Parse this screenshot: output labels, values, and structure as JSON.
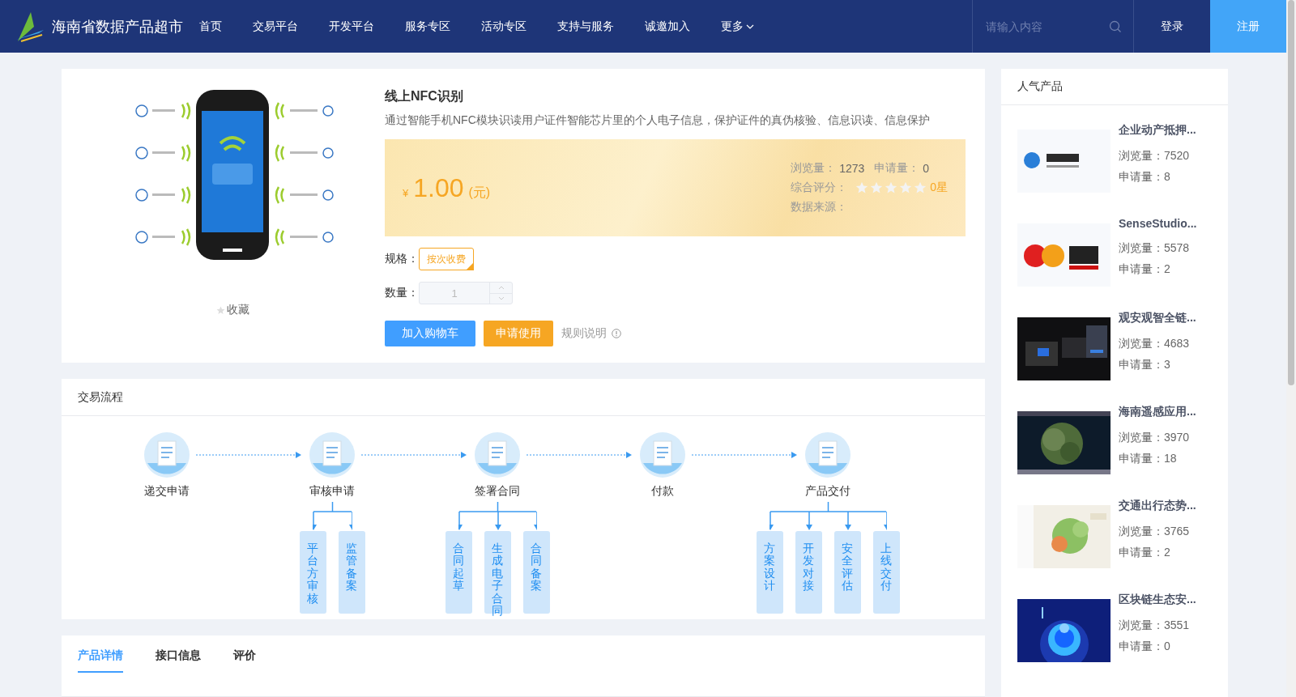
{
  "header": {
    "brand": "海南省数据产品超市",
    "nav": [
      {
        "label": "首页",
        "dropdown": false
      },
      {
        "label": "交易平台",
        "dropdown": false
      },
      {
        "label": "开发平台",
        "dropdown": false
      },
      {
        "label": "服务专区",
        "dropdown": false
      },
      {
        "label": "活动专区",
        "dropdown": false
      },
      {
        "label": "支持与服务",
        "dropdown": false
      },
      {
        "label": "诚邀加入",
        "dropdown": false
      },
      {
        "label": "更多",
        "dropdown": true
      }
    ],
    "search": {
      "placeholder": "请输入内容"
    },
    "login": "登录",
    "register": "注册"
  },
  "product": {
    "favorite": "收藏",
    "title": "线上NFC识别",
    "description": "通过智能手机NFC模块识读用户证件智能芯片里的个人电子信息，保护证件的真伪核验、信息识读、信息保护",
    "currency": "¥",
    "price": "1.00",
    "unit": "(元)",
    "views_label": "浏览量：",
    "views": "1273",
    "applies_label": "申请量：",
    "applies": "0",
    "rating_label": "综合评分：",
    "stars": 0,
    "rating_text": "0星",
    "source_label": "数据来源：",
    "spec_label": "规格：",
    "specs": [
      {
        "label": "按次收费",
        "selected": true
      }
    ],
    "qty_label": "数量：",
    "qty": "1",
    "cart_button": "加入购物车",
    "apply_button": "申请使用",
    "rules_link": "规则说明"
  },
  "flow": {
    "title": "交易流程",
    "steps": [
      {
        "label": "递交申请"
      },
      {
        "label": "审核申请",
        "children": [
          "平台方审核",
          "监管备案"
        ]
      },
      {
        "label": "签署合同",
        "children": [
          "合同起草",
          "生成电子合同",
          "合同备案"
        ]
      },
      {
        "label": "付款"
      },
      {
        "label": "产品交付",
        "children": [
          "方案设计",
          "开发对接",
          "安全评估",
          "上线交付"
        ]
      }
    ]
  },
  "tabs": [
    {
      "label": "产品详情",
      "selected": true
    },
    {
      "label": "接口信息",
      "selected": false
    },
    {
      "label": "评价",
      "selected": false
    }
  ],
  "popular": {
    "title": "人气产品",
    "items": [
      {
        "name": "企业动产抵押...",
        "views": "浏览量：7520",
        "applies": "申请量：8"
      },
      {
        "name": "SenseStudio...",
        "views": "浏览量：5578",
        "applies": "申请量：2"
      },
      {
        "name": "观安观智全链...",
        "views": "浏览量：4683",
        "applies": "申请量：3"
      },
      {
        "name": "海南遥感应用...",
        "views": "浏览量：3970",
        "applies": "申请量：18"
      },
      {
        "name": "交通出行态势...",
        "views": "浏览量：3765",
        "applies": "申请量：2"
      },
      {
        "name": "区块链生态安...",
        "views": "浏览量：3551",
        "applies": "申请量：0"
      }
    ]
  }
}
